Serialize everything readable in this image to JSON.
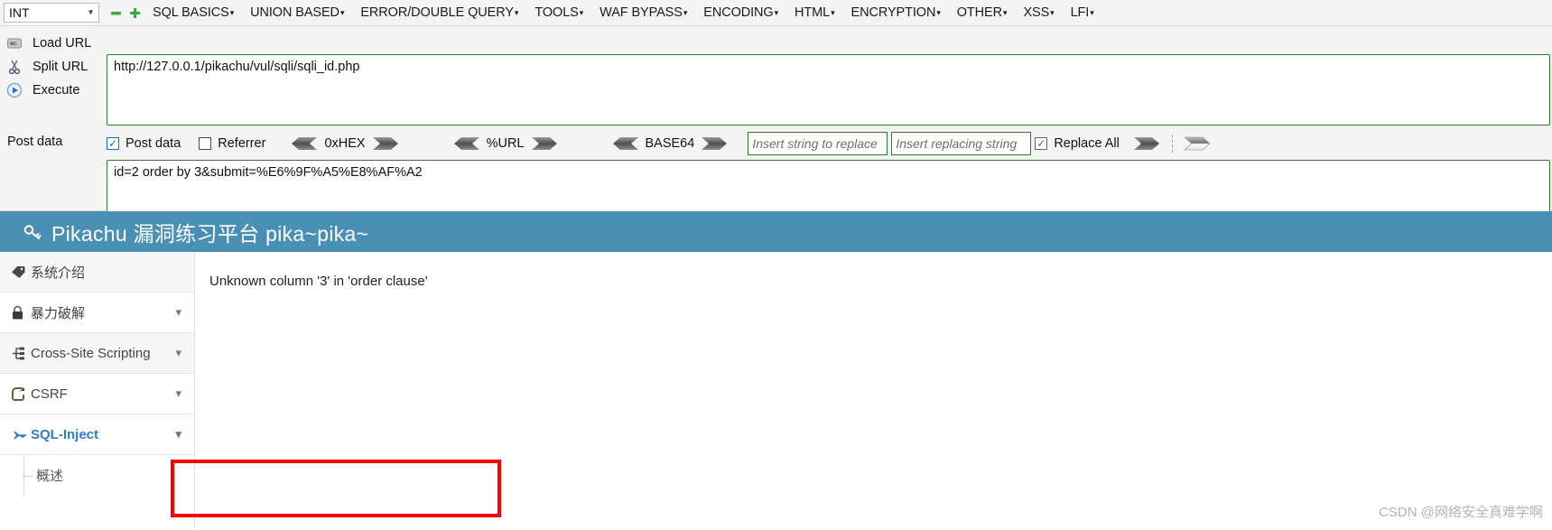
{
  "hackbar": {
    "type_select": {
      "value": "INT",
      "chevron_icon": "chevron-down-icon"
    },
    "mini_buttons": [
      {
        "name": "remove-tab-icon",
        "glyph": "▬",
        "color": "#3cab3c"
      },
      {
        "name": "add-tab-icon",
        "glyph": "✚",
        "color": "#3cab3c"
      }
    ],
    "menus": [
      {
        "label": "SQL BASICS",
        "caret": "▾"
      },
      {
        "label": "UNION BASED",
        "caret": "▾"
      },
      {
        "label": "ERROR/DOUBLE QUERY",
        "caret": "▾"
      },
      {
        "label": "TOOLS",
        "caret": "▾"
      },
      {
        "label": "WAF BYPASS",
        "caret": "▾"
      },
      {
        "label": "ENCODING",
        "caret": "▾"
      },
      {
        "label": "HTML",
        "caret": "▾"
      },
      {
        "label": "ENCRYPTION",
        "caret": "▾"
      },
      {
        "label": "OTHER",
        "caret": "▾"
      },
      {
        "label": "XSS",
        "caret": "▾"
      },
      {
        "label": "LFI",
        "caret": "▾"
      }
    ],
    "actions": [
      {
        "label": "Load URL",
        "icon": "load-url-icon"
      },
      {
        "label": "Split URL",
        "icon": "split-url-icon"
      },
      {
        "label": "Execute",
        "icon": "execute-icon"
      }
    ],
    "url_value": "http://127.0.0.1/pikachu/vul/sqli/sqli_id.php",
    "options": {
      "post_data_label": "Post data",
      "post_data_checked": true,
      "referrer_label": "Referrer",
      "referrer_checked": false,
      "encoders": [
        {
          "label": "0xHEX"
        },
        {
          "label": "%URL"
        },
        {
          "label": "BASE64"
        }
      ],
      "replace_from_placeholder": "Insert string to replace",
      "replace_to_placeholder": "Insert replacing string",
      "replace_all_label": "Replace All",
      "replace_all_checked": true
    },
    "post_data_side_label": "Post data",
    "post_data_value": "id=2 order by 3&submit=%E6%9F%A5%E8%AF%A2"
  },
  "pikachu": {
    "header_title": "Pikachu 漏洞练习平台 pika~pika~",
    "header_icon": "key-icon",
    "header_color": "#4a90b4",
    "sidebar": [
      {
        "label": "系统介绍",
        "icon": "tag-icon",
        "chevron": "",
        "active": false,
        "shaded": true
      },
      {
        "label": "暴力破解",
        "icon": "lock-icon",
        "chevron": "⌄",
        "active": false,
        "shaded": false
      },
      {
        "label": "Cross-Site Scripting",
        "icon": "sitemap-icon",
        "chevron": "⌄",
        "active": false,
        "shaded": true
      },
      {
        "label": "CSRF",
        "icon": "share-icon",
        "chevron": "⌄",
        "active": false,
        "shaded": false
      },
      {
        "label": "SQL-Inject",
        "icon": "plane-icon",
        "chevron": "⌄",
        "active": true,
        "shaded": true
      }
    ],
    "sidebar_sub": [
      {
        "label": "概述"
      }
    ],
    "error_message": "Unknown column '3' in 'order clause'",
    "annotation_color": "#ff0000"
  },
  "watermark": "CSDN @网络安全真难学啊"
}
